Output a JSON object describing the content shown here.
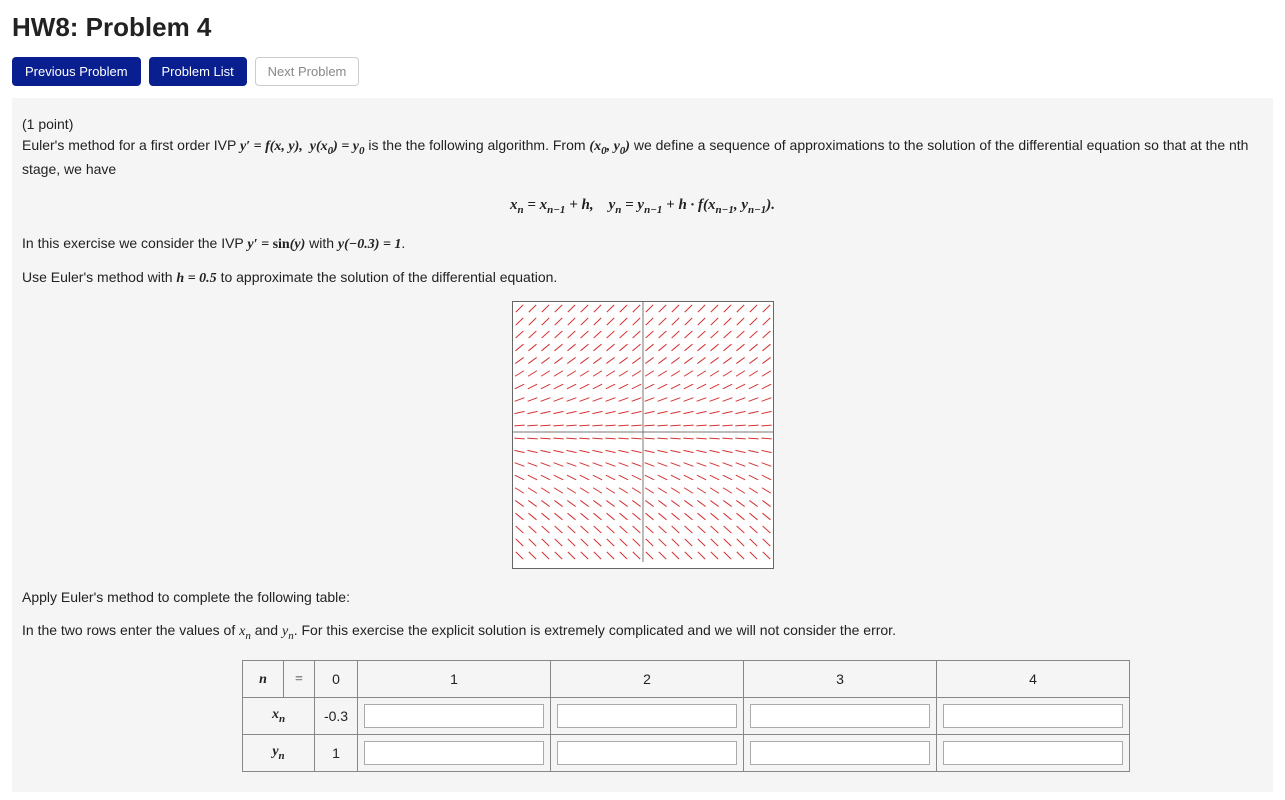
{
  "title": "HW8: Problem 4",
  "nav": {
    "prev": "Previous Problem",
    "list": "Problem List",
    "next": "Next Problem"
  },
  "problem": {
    "points_label": "(1 point)",
    "intro_1": "Euler's method for a first order IVP ",
    "intro_math1": "y′ = f(x, y),  y(x₀) = y₀",
    "intro_2": " is the the following algorithm. From ",
    "intro_math2": "(x₀, y₀)",
    "intro_3": " we define a sequence of approximations to the solution of the differential equation so that at the nth stage, we have",
    "eq_block": "xₙ = xₙ₋₁ + h,   yₙ = yₙ₋₁ + h · f(xₙ₋₁, yₙ₋₁).",
    "exercise_1": "In this exercise we consider the IVP ",
    "exercise_math1": "y′ = sin(y)",
    "exercise_with": " with ",
    "exercise_math2": "y(−0.3) = 1",
    "exercise_period": ".",
    "use_1": "Use Euler's method with ",
    "use_math": "h = 0.5",
    "use_2": " to approximate the solution of the differential equation.",
    "apply_text": "Apply Euler's method to complete the following table:",
    "rows_1": "In the two rows enter the values of ",
    "rows_xn": "xₙ",
    "rows_and": " and ",
    "rows_yn": "yₙ",
    "rows_2": ". For this exercise the explicit solution is extremely complicated and we will not consider the error."
  },
  "table": {
    "n_label": "n",
    "eq_label": "=",
    "xn_label": "xₙ",
    "yn_label": "yₙ",
    "cols": [
      "0",
      "1",
      "2",
      "3",
      "4"
    ],
    "x0": "-0.3",
    "y0": "1",
    "x_inputs": [
      "",
      "",
      "",
      ""
    ],
    "y_inputs": [
      "",
      "",
      "",
      ""
    ]
  },
  "chart_data": {
    "type": "direction-field",
    "xrange": [
      -1.5,
      1.5
    ],
    "yrange": [
      -1.5,
      1.5
    ],
    "gridstep": 0.15,
    "dash_len": 0.06,
    "ode": "y' = sin(y)",
    "axis_color": "#777",
    "dash_color": "#d63333"
  }
}
